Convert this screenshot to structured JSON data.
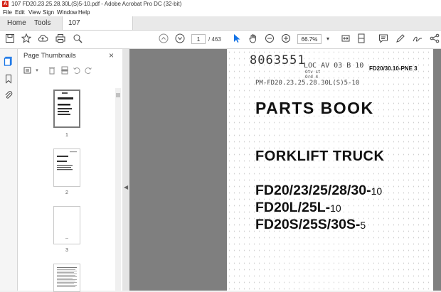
{
  "window": {
    "title": "107 FD20.23.25.28.30L(S)5-10.pdf - Adobe Acrobat Pro DC (32-bit)",
    "app_icon_label": "A"
  },
  "menu": [
    "File",
    "Edit",
    "View",
    "Sign",
    "Window",
    "Help"
  ],
  "tabs": {
    "home": "Home",
    "tools": "Tools",
    "document": "107 FD20.23.25.28....",
    "close": "×"
  },
  "toolbar": {
    "current_page": "1",
    "total_pages": "/ 463",
    "zoom": "66.7%"
  },
  "thumbnails_panel": {
    "title": "Page Thumbnails",
    "close": "×",
    "pages": [
      "1",
      "2",
      "3"
    ]
  },
  "document": {
    "stamp_number": "8063551",
    "loc_line": "LOC AV 03 B 10",
    "stamp_small_1": "Otv st",
    "stamp_small_2": "Ord   4",
    "part_ref": "PM-FD20.23.25.28.30L(S)5-10",
    "doc_code": "FD20/30.10-PNE 3",
    "heading": "PARTS BOOK",
    "subheading": "FORKLIFT TRUCK",
    "model_line_1": "FD20/23/25/28/30-",
    "model_line_1_suffix": "10",
    "model_line_2": "FD20L/25L-",
    "model_line_2_suffix": "10",
    "model_line_3": "FD20S/25S/30S-",
    "model_line_3_suffix": "5"
  },
  "colors": {
    "canvas_bg": "#7f7f7f",
    "acrobat_red": "#d4261b",
    "active_tool": "#1473e6"
  }
}
